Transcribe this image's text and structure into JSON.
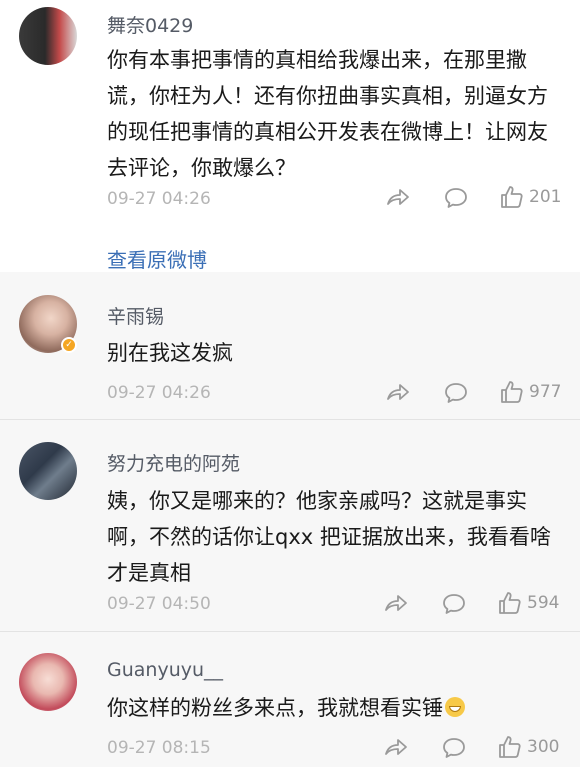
{
  "comments": [
    {
      "username": "舞奈0429",
      "text": "你有本事把事情的真相给我爆出来，在那里撒谎，你枉为人！还有你扭曲事实真相，别逼女方的现任把事情的真相公开发表在微博上！让网友去评论，你敢爆么？",
      "time": "09-27 04:26",
      "likes": "201",
      "view_original_label": "查看原微博"
    },
    {
      "username": "辛雨锡",
      "text": "别在我这发疯",
      "time": "09-27 04:26",
      "likes": "977",
      "verified": true
    },
    {
      "username": "努力充电的阿苑",
      "text": "姨，你又是哪来的？他家亲戚吗？这就是事实啊，不然的话你让qxx 把证据放出来，我看看啥才是真相",
      "time": "09-27 04:50",
      "likes": "594"
    },
    {
      "username": "Guanyuyu__",
      "text": "你这样的粉丝多来点，我就想看实锤",
      "time": "09-27 08:15",
      "likes": "300",
      "trailing_icon": "grinning-emoji"
    }
  ],
  "colors": {
    "username": "#555b66",
    "meta": "#b5b5b5",
    "link": "#3b6fb6",
    "reply_background": "#f7f7f7",
    "verified_badge": "#f5a623"
  }
}
